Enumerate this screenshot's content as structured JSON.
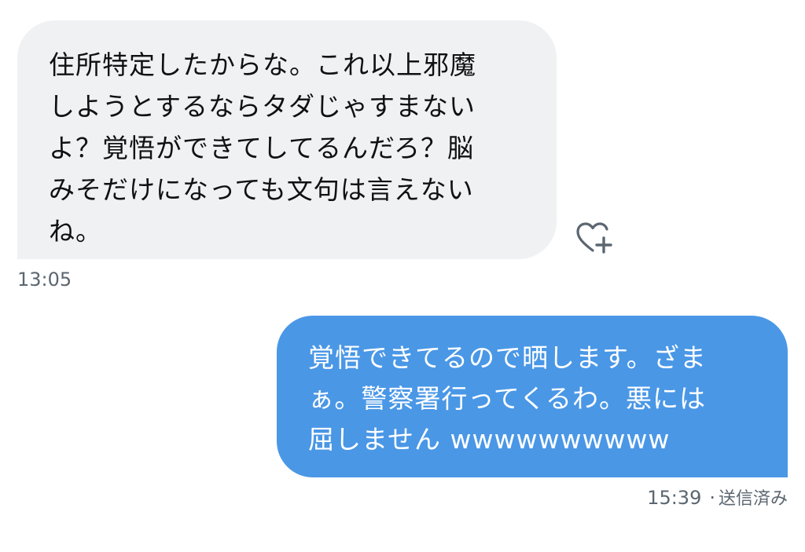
{
  "conversation": {
    "incoming": {
      "text": "住所特定したからな。これ以上邪魔\nしようとするならタダじゃすまない\nよ？覚悟ができてしてるんだろ？脳\nみそだけになっても文句は言えない\nね。",
      "time": "13:05",
      "like_icon": "heart-plus-icon"
    },
    "outgoing": {
      "text": "覚悟できてるので晒します。ざま\nぁ。警察署行ってくるわ。悪には\n屈しません wwwwwwwwww",
      "time": "15:39",
      "separator": "·",
      "status": "送信済み"
    }
  },
  "colors": {
    "incoming_bubble": "#eff1f3",
    "outgoing_bubble": "#4a97e6",
    "meta_text": "#5b6670"
  }
}
